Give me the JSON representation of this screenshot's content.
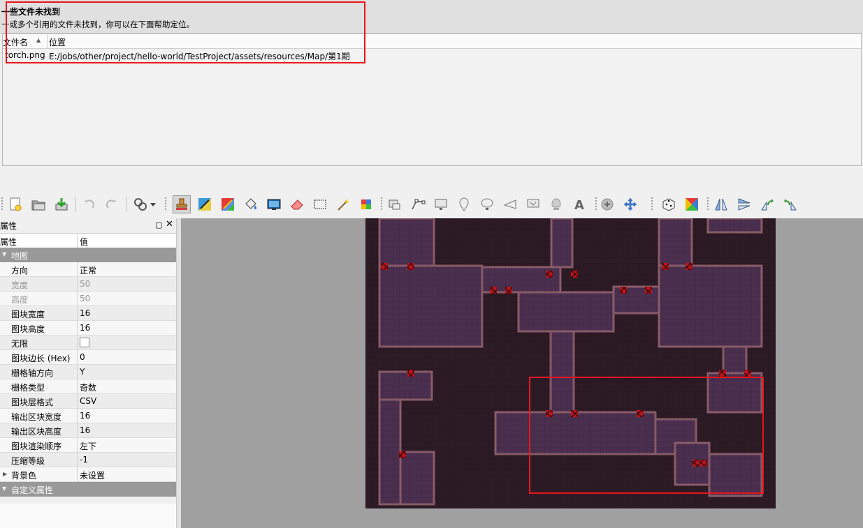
{
  "missing_files": {
    "title": "一些文件未找到",
    "description": "一或多个引用的文件未找到，你可以在下面帮助定位。",
    "columns": {
      "file": "文件名",
      "location": "位置"
    },
    "rows": [
      {
        "file": "torch.png",
        "location": "E:/jobs/other/project/hello-world/TestProject/assets/resources/Map/第1期"
      }
    ],
    "highlight_color": "#e8151b"
  },
  "toolbar": {
    "icons": [
      "new-map-icon",
      "open-file-icon",
      "save-icon",
      "undo-icon",
      "redo-icon",
      "commands-icon",
      "dropdown-arrow-icon",
      "stamp-brush-icon",
      "terrain-brush-icon",
      "wang-brush-icon",
      "bucket-fill-icon",
      "shape-fill-icon",
      "eraser-icon",
      "rectangular-select-icon",
      "magic-wand-icon",
      "select-same-tile-icon",
      "select-objects-icon",
      "edit-polygons-icon",
      "insert-rectangle-icon",
      "insert-point-icon",
      "insert-ellipse-icon",
      "insert-polygon-icon",
      "insert-tile-icon",
      "insert-template-icon",
      "insert-text-icon",
      "layer-offset-icon",
      "move-icon",
      "random-mode-icon",
      "wang-fill-mode-icon",
      "flip-horizontal-icon",
      "flip-vertical-icon",
      "rotate-left-icon",
      "rotate-right-icon"
    ],
    "active_tool": "stamp-brush-icon"
  },
  "properties": {
    "title": "属性",
    "header": {
      "name": "属性",
      "value": "值"
    },
    "map_group": "地图",
    "rows": [
      {
        "name": "方向",
        "value": "正常"
      },
      {
        "name": "宽度",
        "value": "50",
        "dim": true
      },
      {
        "name": "高度",
        "value": "50",
        "dim": true
      },
      {
        "name": "图块宽度",
        "value": "16"
      },
      {
        "name": "图块高度",
        "value": "16"
      },
      {
        "name": "无限",
        "value": ""
      },
      {
        "name": "图块边长 (Hex)",
        "value": "0"
      },
      {
        "name": "栅格轴方向",
        "value": "Y"
      },
      {
        "name": "栅格类型",
        "value": "奇数"
      },
      {
        "name": "图块层格式",
        "value": "CSV"
      },
      {
        "name": "输出区块宽度",
        "value": "16"
      },
      {
        "name": "输出区块高度",
        "value": "16"
      },
      {
        "name": "图块渲染顺序",
        "value": "左下"
      },
      {
        "name": "压缩等级",
        "value": "-1"
      },
      {
        "name": "背景色",
        "value": "未设置"
      }
    ],
    "custom_group": "自定义属性"
  },
  "map": {
    "background_color": "#2c1a25",
    "floor_color": "#4a2f4f",
    "wall_color": "#8a5c68",
    "missing_tile_color": "#b5161c",
    "highlight_color": "#e8151b"
  }
}
